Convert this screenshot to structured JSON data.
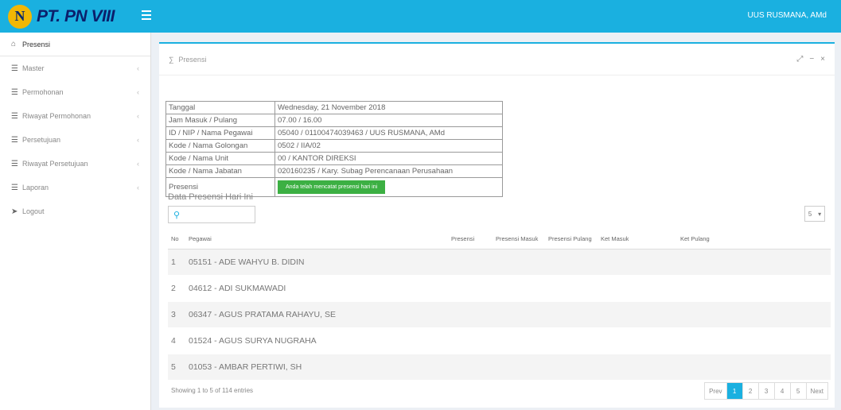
{
  "header": {
    "brand_logo_letter": "N",
    "brand": "PT. PN VIII",
    "user": "UUS RUSMANA, AMd"
  },
  "sidebar": {
    "items": [
      {
        "label": "Presensi",
        "icon": "home-icon",
        "active": true
      },
      {
        "label": "Master",
        "icon": "list-icon"
      },
      {
        "label": "Permohonan",
        "icon": "list-icon"
      },
      {
        "label": "Riwayat Permohonan",
        "icon": "list-icon"
      },
      {
        "label": "Persetujuan",
        "icon": "list-icon"
      },
      {
        "label": "Riwayat Persetujuan",
        "icon": "list-icon"
      },
      {
        "label": "Laporan",
        "icon": "list-icon"
      },
      {
        "label": "Logout",
        "icon": "logout-icon"
      }
    ]
  },
  "panel": {
    "title": "Presensi"
  },
  "info": {
    "rows": [
      {
        "key": "Tanggal",
        "value": "Wednesday, 21 November 2018"
      },
      {
        "key": "Jam Masuk / Pulang",
        "value": "07.00 / 16.00"
      },
      {
        "key": "ID / NIP / Nama Pegawai",
        "value": "05040 / 01100474039463 / UUS RUSMANA, AMd"
      },
      {
        "key": "Kode / Nama Golongan",
        "value": "0502 / IIA/02"
      },
      {
        "key": "Kode / Nama Unit",
        "value": "00 / KANTOR DIREKSI"
      },
      {
        "key": "Kode / Nama Jabatan",
        "value": "020160235 / Kary. Subag Perencanaan Perusahaan"
      }
    ],
    "presensi_label": "Presensi",
    "presensi_status": "Anda telah mencatat presensi hari ini"
  },
  "today": {
    "title": "Data Presensi Hari Ini",
    "page_size": "5",
    "columns": [
      "No",
      "Pegawai",
      "Presensi",
      "Presensi Masuk",
      "Presensi Pulang",
      "Ket Masuk",
      "Ket Pulang"
    ],
    "rows": [
      {
        "no": "1",
        "pegawai": "05151 - ADE WAHYU B. DIDIN"
      },
      {
        "no": "2",
        "pegawai": "04612 - ADI SUKMAWADI"
      },
      {
        "no": "3",
        "pegawai": "06347 - AGUS PRATAMA RAHAYU, SE"
      },
      {
        "no": "4",
        "pegawai": "01524 - AGUS SURYA NUGRAHA"
      },
      {
        "no": "5",
        "pegawai": "01053 - AMBAR PERTIWI, SH"
      }
    ],
    "footer": "Showing 1 to 5 of 114 entries",
    "pager": [
      "Prev",
      "1",
      "2",
      "3",
      "4",
      "5",
      "Next"
    ]
  },
  "colors": {
    "accent": "#1ab0e0",
    "success": "#3cb043",
    "brand_text": "#0b1f6b",
    "logo": "#f2b705"
  }
}
